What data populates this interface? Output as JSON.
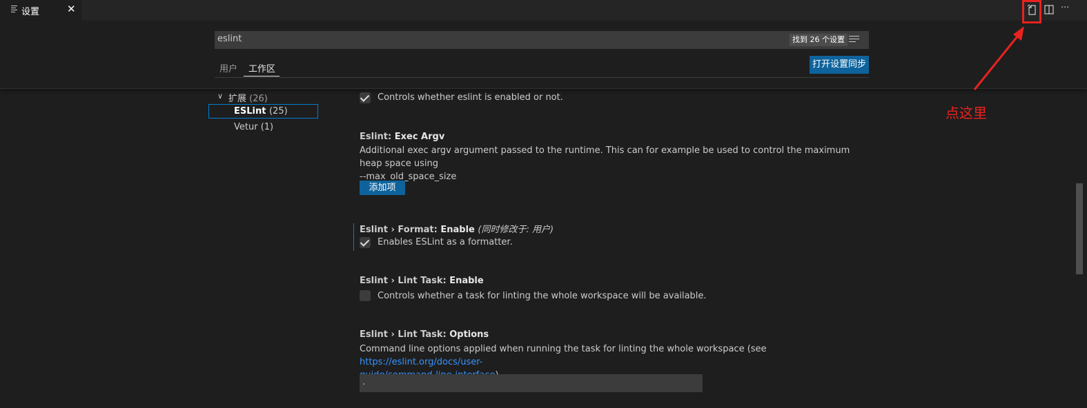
{
  "tab": {
    "label": "设置",
    "close": "✕"
  },
  "actions": {
    "more": "···"
  },
  "search": {
    "value": "eslint",
    "result_count": "找到 26 个设置"
  },
  "scope_tabs": {
    "user": "用户",
    "workspace": "工作区"
  },
  "sync_button": "打开设置同步",
  "toc": {
    "group_label": "扩展",
    "group_count": "(26)",
    "items": [
      {
        "label": "ESLint",
        "count": "(25)"
      },
      {
        "label": "Vetur",
        "count": "(1)"
      }
    ]
  },
  "settings": {
    "enable": {
      "desc": "Controls whether eslint is enabled or not.",
      "checked": true
    },
    "exec_argv": {
      "title_prefix": "Eslint: ",
      "title_key": "Exec Argv",
      "desc_line1": "Additional exec argv argument passed to the runtime. This can for example be used to control the maximum heap space using",
      "desc_line2": "--max_old_space_size",
      "button": "添加项"
    },
    "format_enable": {
      "title_prefix": "Eslint › Format: ",
      "title_key": "Enable",
      "modified": "(同时修改于: 用户)",
      "desc": "Enables ESLint as a formatter.",
      "checked": true
    },
    "lint_task_enable": {
      "title_prefix": "Eslint › Lint Task: ",
      "title_key": "Enable",
      "desc": "Controls whether a task for linting the whole workspace will be available.",
      "checked": false
    },
    "lint_task_options": {
      "title_prefix": "Eslint › Lint Task: ",
      "title_key": "Options",
      "desc_line1_pre": "Command line options applied when running the task for linting the whole workspace (see ",
      "desc_link_part1": "https://eslint.org/docs/user-",
      "desc_link_part2": "guide/command-line-interface",
      "desc_line2_post": ").",
      "value": "."
    }
  },
  "annotation": {
    "label": "点这里",
    "color": "#e8231f"
  },
  "icons": [
    "file-icon",
    "split-editor-icon",
    "more-icon",
    "filter-icon",
    "chevron-down-icon",
    "check-icon"
  ]
}
